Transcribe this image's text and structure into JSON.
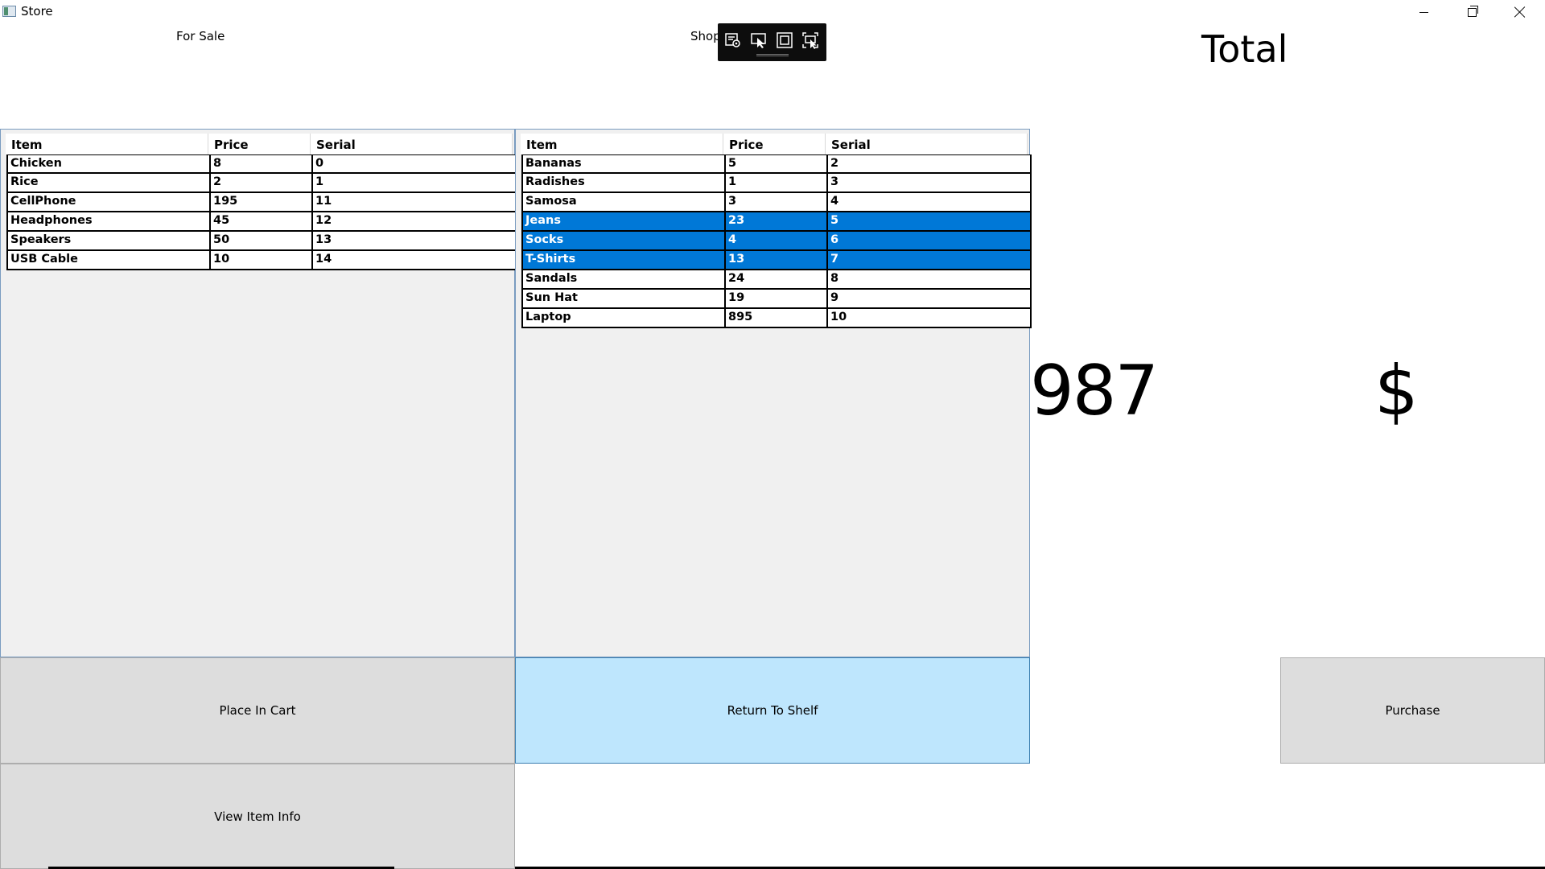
{
  "window": {
    "title": "Store"
  },
  "labels": {
    "for_sale": "For Sale",
    "shop": "Shop",
    "total": "Total",
    "total_amount": "987",
    "currency": "$"
  },
  "for_sale_table": {
    "columns": [
      "Item",
      "Price",
      "Serial"
    ],
    "rows": [
      [
        "Chicken",
        "8",
        "0"
      ],
      [
        "Rice",
        "2",
        "1"
      ],
      [
        "CellPhone",
        "195",
        "11"
      ],
      [
        "Headphones",
        "45",
        "12"
      ],
      [
        "Speakers",
        "50",
        "13"
      ],
      [
        "USB Cable",
        "10",
        "14"
      ]
    ]
  },
  "shop_table": {
    "columns": [
      "Item",
      "Price",
      "Serial"
    ],
    "rows": [
      [
        "Bananas",
        "5",
        "2"
      ],
      [
        "Radishes",
        "1",
        "3"
      ],
      [
        "Samosa",
        "3",
        "4"
      ],
      [
        "Jeans",
        "23",
        "5"
      ],
      [
        "Socks",
        "4",
        "6"
      ],
      [
        "T-Shirts",
        "13",
        "7"
      ],
      [
        "Sandals",
        "24",
        "8"
      ],
      [
        "Sun Hat",
        "19",
        "9"
      ],
      [
        "Laptop",
        "895",
        "10"
      ]
    ],
    "selected_rows": [
      3,
      4,
      5
    ]
  },
  "buttons": {
    "place_in_cart": "Place In Cart",
    "view_item_info": "View Item Info",
    "return_to_shelf": "Return To Shelf",
    "purchase": "Purchase"
  },
  "debug_toolbar": {
    "icons": [
      "live-visual-tree-icon",
      "select-element-icon",
      "display-layout-adorners-icon",
      "track-focus-icon"
    ]
  },
  "colors": {
    "selection": "#0078d7",
    "button_face": "#dddddd",
    "button_hover": "#bee6fd",
    "grid_background": "#f0f0f0"
  }
}
